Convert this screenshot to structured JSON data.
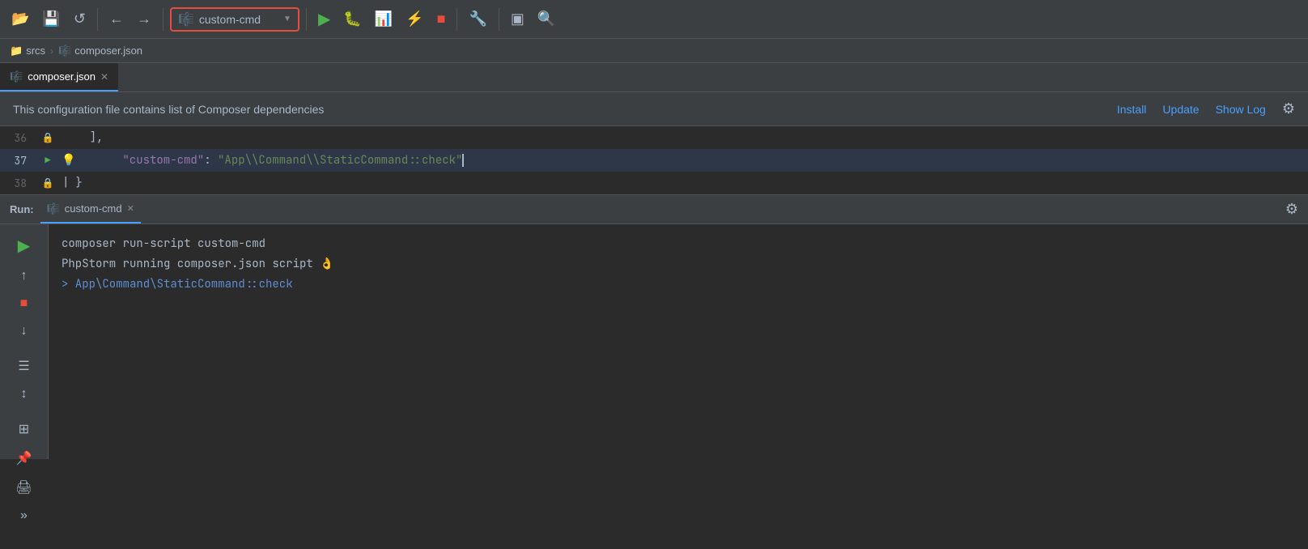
{
  "toolbar": {
    "run_config_name": "custom-cmd",
    "run_config_icon": "⚙",
    "buttons": [
      {
        "name": "open-folder",
        "icon": "📂"
      },
      {
        "name": "save",
        "icon": "💾"
      },
      {
        "name": "refresh",
        "icon": "↺"
      },
      {
        "name": "back",
        "icon": "←"
      },
      {
        "name": "forward",
        "icon": "→"
      },
      {
        "name": "run",
        "icon": "▶"
      },
      {
        "name": "debug",
        "icon": "🐛"
      },
      {
        "name": "coverage",
        "icon": "📊"
      },
      {
        "name": "profile",
        "icon": "⚡"
      },
      {
        "name": "stop",
        "icon": "■"
      },
      {
        "name": "settings",
        "icon": "🔧"
      },
      {
        "name": "terminal",
        "icon": "▣"
      },
      {
        "name": "search",
        "icon": "🔍"
      }
    ]
  },
  "breadcrumb": {
    "items": [
      {
        "name": "srcs",
        "icon": "📁"
      },
      {
        "name": "composer.json",
        "icon": "🎼"
      }
    ]
  },
  "editor_tab": {
    "label": "composer.json",
    "icon": "🎼"
  },
  "info_bar": {
    "text": "This configuration file contains list of Composer dependencies",
    "install_label": "Install",
    "update_label": "Update",
    "show_log_label": "Show Log"
  },
  "code": {
    "lines": [
      {
        "number": "36",
        "content": "    ],"
      },
      {
        "number": "37",
        "content": "    \"custom-cmd\": \"App\\\\Command\\\\StaticCommand::check\""
      },
      {
        "number": "38",
        "content": "}"
      }
    ]
  },
  "run_panel": {
    "label": "Run:",
    "tab_name": "custom-cmd",
    "lines": [
      {
        "type": "cmd",
        "text": "composer run-script custom-cmd"
      },
      {
        "type": "info",
        "text": "PhpStorm running composer.json script 👌"
      },
      {
        "type": "exec",
        "text": "> App\\Command\\StaticCommand::check"
      }
    ]
  }
}
